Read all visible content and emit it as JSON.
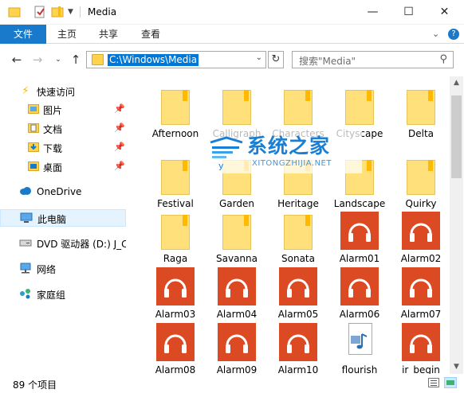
{
  "window": {
    "title": "Media",
    "minimize": "—",
    "maximize": "☐",
    "close": "✕"
  },
  "ribbon": {
    "file_tab": "文件",
    "tabs": [
      "主页",
      "共享",
      "查看"
    ],
    "expand_icon": "chevron-down-icon",
    "help_icon": "help-icon"
  },
  "address": {
    "path": "C:\\Windows\\Media",
    "search_placeholder": "搜索\"Media\""
  },
  "nav": {
    "quick_access": "快速访问",
    "quick_items": [
      "图片",
      "文档",
      "下载",
      "桌面"
    ],
    "onedrive": "OneDrive",
    "this_pc": "此电脑",
    "dvd": "DVD 驱动器 (D:) J_C",
    "network": "网络",
    "homegroup": "家庭组"
  },
  "files": [
    {
      "name": "Afternoon",
      "type": "folder"
    },
    {
      "name": "Calligraph",
      "type": "folder"
    },
    {
      "name": "Characters",
      "type": "folder"
    },
    {
      "name": "Cityscape",
      "type": "folder"
    },
    {
      "name": "Delta",
      "type": "folder"
    },
    {
      "name": "Festival",
      "type": "folder"
    },
    {
      "name": "Garden",
      "type": "folder"
    },
    {
      "name": "Heritage",
      "type": "folder"
    },
    {
      "name": "Landscape",
      "type": "folder"
    },
    {
      "name": "Quirky",
      "type": "folder"
    },
    {
      "name": "Raga",
      "type": "folder"
    },
    {
      "name": "Savanna",
      "type": "folder"
    },
    {
      "name": "Sonata",
      "type": "folder"
    },
    {
      "name": "Alarm01",
      "type": "audio"
    },
    {
      "name": "Alarm02",
      "type": "audio"
    },
    {
      "name": "Alarm03",
      "type": "audio"
    },
    {
      "name": "Alarm04",
      "type": "audio"
    },
    {
      "name": "Alarm05",
      "type": "audio"
    },
    {
      "name": "Alarm06",
      "type": "audio"
    },
    {
      "name": "Alarm07",
      "type": "audio"
    },
    {
      "name": "Alarm08",
      "type": "audio"
    },
    {
      "name": "Alarm09",
      "type": "audio"
    },
    {
      "name": "Alarm10",
      "type": "audio"
    },
    {
      "name": "flourish",
      "type": "midi"
    },
    {
      "name": "ir_begin",
      "type": "audio"
    }
  ],
  "status": {
    "item_count": "89 个项目"
  },
  "watermark": {
    "title": "系统之家",
    "subtitle": "XITONGZHIJIA.NET"
  },
  "colors": {
    "accent": "#1979ca",
    "folder": "#ffe07a",
    "audio_tile": "#db4a23",
    "watermark": "#1a7fd4"
  }
}
